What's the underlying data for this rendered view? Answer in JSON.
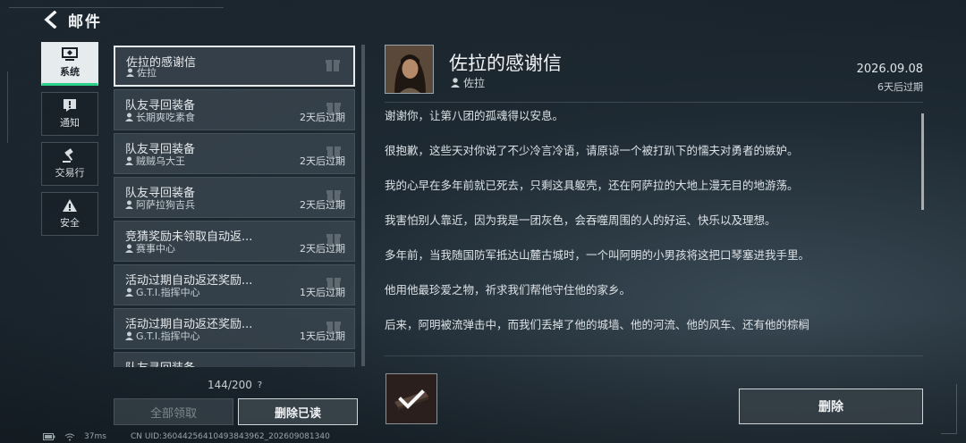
{
  "header": {
    "title": "邮件"
  },
  "rail": [
    {
      "label": "系统",
      "icon": "monitor-icon",
      "active": true
    },
    {
      "label": "通知",
      "icon": "alert-icon",
      "active": false
    },
    {
      "label": "交易行",
      "icon": "gavel-icon",
      "active": false
    },
    {
      "label": "安全",
      "icon": "warning-icon",
      "active": false
    }
  ],
  "mails": [
    {
      "title": "佐拉的感谢信",
      "sender": "佐拉",
      "expiry": ""
    },
    {
      "title": "队友寻回装备",
      "sender": "长期爽吃素食",
      "expiry": "2天后过期"
    },
    {
      "title": "队友寻回装备",
      "sender": "贼贼乌大王",
      "expiry": "2天后过期"
    },
    {
      "title": "队友寻回装备",
      "sender": "阿萨拉狗吉兵",
      "expiry": "2天后过期"
    },
    {
      "title": "竞猜奖励未领取自动返...",
      "sender": "赛事中心",
      "expiry": "2天后过期"
    },
    {
      "title": "活动过期自动返还奖励...",
      "sender": "G.T.I.指挥中心",
      "expiry": "1天后过期"
    },
    {
      "title": "活动过期自动返还奖励...",
      "sender": "G.T.I.指挥中心",
      "expiry": "1天后过期"
    },
    {
      "title": "队友寻回装备",
      "sender": "",
      "expiry": ""
    }
  ],
  "list": {
    "count": "144/200",
    "count_help": "?",
    "claim_all": "全部领取",
    "delete_read": "删除已读"
  },
  "detail": {
    "title": "佐拉的感谢信",
    "sender": "佐拉",
    "date": "2026.09.08",
    "expiry": "6天后过期",
    "paragraphs": [
      "谢谢你，让第八团的孤魂得以安息。",
      "很抱歉，这些天对你说了不少冷言冷语，请原谅一个被打趴下的懦夫对勇者的嫉妒。",
      "我的心早在多年前就已死去，只剩这具躯壳，还在阿萨拉的大地上漫无目的地游荡。",
      "我害怕别人靠近，因为我是一团灰色，会吞噬周围的人的好运、快乐以及理想。",
      "多年前，当我随国防军抵达山麓古城时，一个叫阿明的小男孩将这把口琴塞进我手里。",
      "他用他最珍爱之物，祈求我们帮他守住他的家乡。",
      "后来，阿明被流弹击中，而我们丢掉了他的城墙、他的河流、他的风车、还有他的棕榈"
    ],
    "delete": "删除"
  },
  "footer": {
    "ping": "37ms",
    "uid": "CN UID:36044256410493843962_202609081340"
  },
  "colors": {
    "accent": "#2dd28a",
    "panel": "#3c4852",
    "text": "#dce2e6"
  }
}
